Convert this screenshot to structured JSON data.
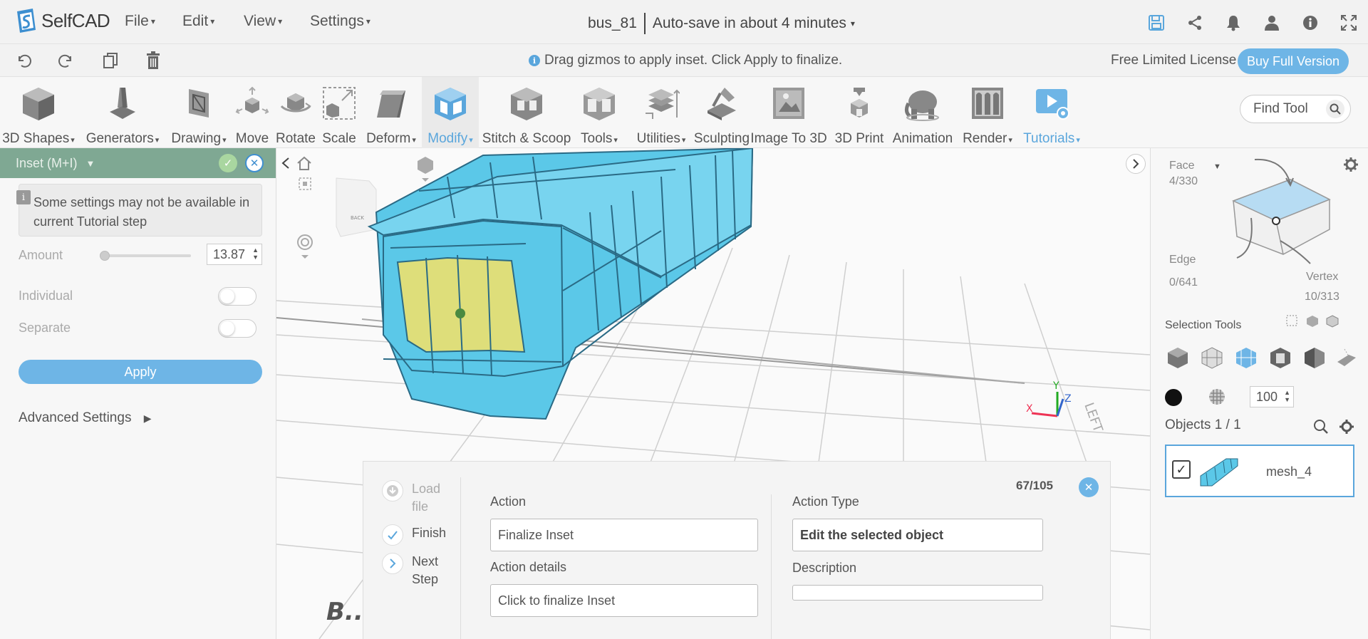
{
  "app": {
    "name": "SelfCAD"
  },
  "menu": [
    {
      "label": "File"
    },
    {
      "label": "Edit"
    },
    {
      "label": "View"
    },
    {
      "label": "Settings"
    }
  ],
  "document": {
    "name": "bus_81",
    "autosave": "Auto-save in about 4 minutes"
  },
  "hint": "Drag gizmos to apply inset. Click Apply to finalize.",
  "license": {
    "text": "Free Limited License",
    "buy_label": "Buy Full Version"
  },
  "toolbar": {
    "tools": [
      {
        "label": "3D Shapes",
        "has_menu": true
      },
      {
        "label": "Generators",
        "has_menu": true
      },
      {
        "label": "Drawing",
        "has_menu": true
      },
      {
        "label": "Move"
      },
      {
        "label": "Rotate"
      },
      {
        "label": "Scale"
      },
      {
        "label": "Deform",
        "has_menu": true
      },
      {
        "label": "Modify",
        "has_menu": true,
        "active": true
      },
      {
        "label": "Stitch & Scoop"
      },
      {
        "label": "Tools",
        "has_menu": true
      },
      {
        "label": "Utilities",
        "has_menu": true
      },
      {
        "label": "Sculpting"
      },
      {
        "label": "Image To 3D"
      },
      {
        "label": "3D Print"
      },
      {
        "label": "Animation"
      },
      {
        "label": "Render",
        "has_menu": true
      },
      {
        "label": "Tutorials",
        "has_menu": true
      }
    ],
    "find_placeholder": "Find Tool"
  },
  "inset_panel": {
    "title": "Inset (M+I)",
    "notice": "Some settings may not be available in current Tutorial step",
    "amount_label": "Amount",
    "amount_value": "13.87",
    "amount_fraction": 0.0,
    "individual_label": "Individual",
    "separate_label": "Separate",
    "apply_label": "Apply",
    "advanced_label": "Advanced Settings"
  },
  "selection": {
    "face_label": "Face",
    "face_count": "4/330",
    "edge_label": "Edge",
    "edge_count": "0/641",
    "vertex_label": "Vertex",
    "vertex_count": "10/313",
    "tools_label": "Selection Tools",
    "opacity": "100"
  },
  "objects": {
    "title": "Objects 1 / 1",
    "items": [
      {
        "name": "mesh_4",
        "checked": true
      }
    ]
  },
  "tutorial": {
    "counter": "67/105",
    "steps": [
      {
        "label": "Load file",
        "state": "dim"
      },
      {
        "label": "Finish",
        "state": "done"
      },
      {
        "label": "Next Step",
        "state": "next"
      }
    ],
    "action_label": "Action",
    "action_value": "Finalize Inset",
    "details_label": "Action details",
    "details_value": "Click to finalize Inset",
    "type_label": "Action Type",
    "type_value": "Edit the selected object",
    "description_label": "Description",
    "description_value": ""
  },
  "viewport": {
    "cube_face_label": "BACK",
    "axis": {
      "x": "X",
      "y": "Y",
      "z": "Z"
    },
    "side_label": "LEFT",
    "floor_label": "B..."
  },
  "colors": {
    "accent": "#5aa6dc",
    "mesh": "#5bc8e8",
    "selected_face": "#dede7a",
    "panel_header": "#7fa893"
  }
}
